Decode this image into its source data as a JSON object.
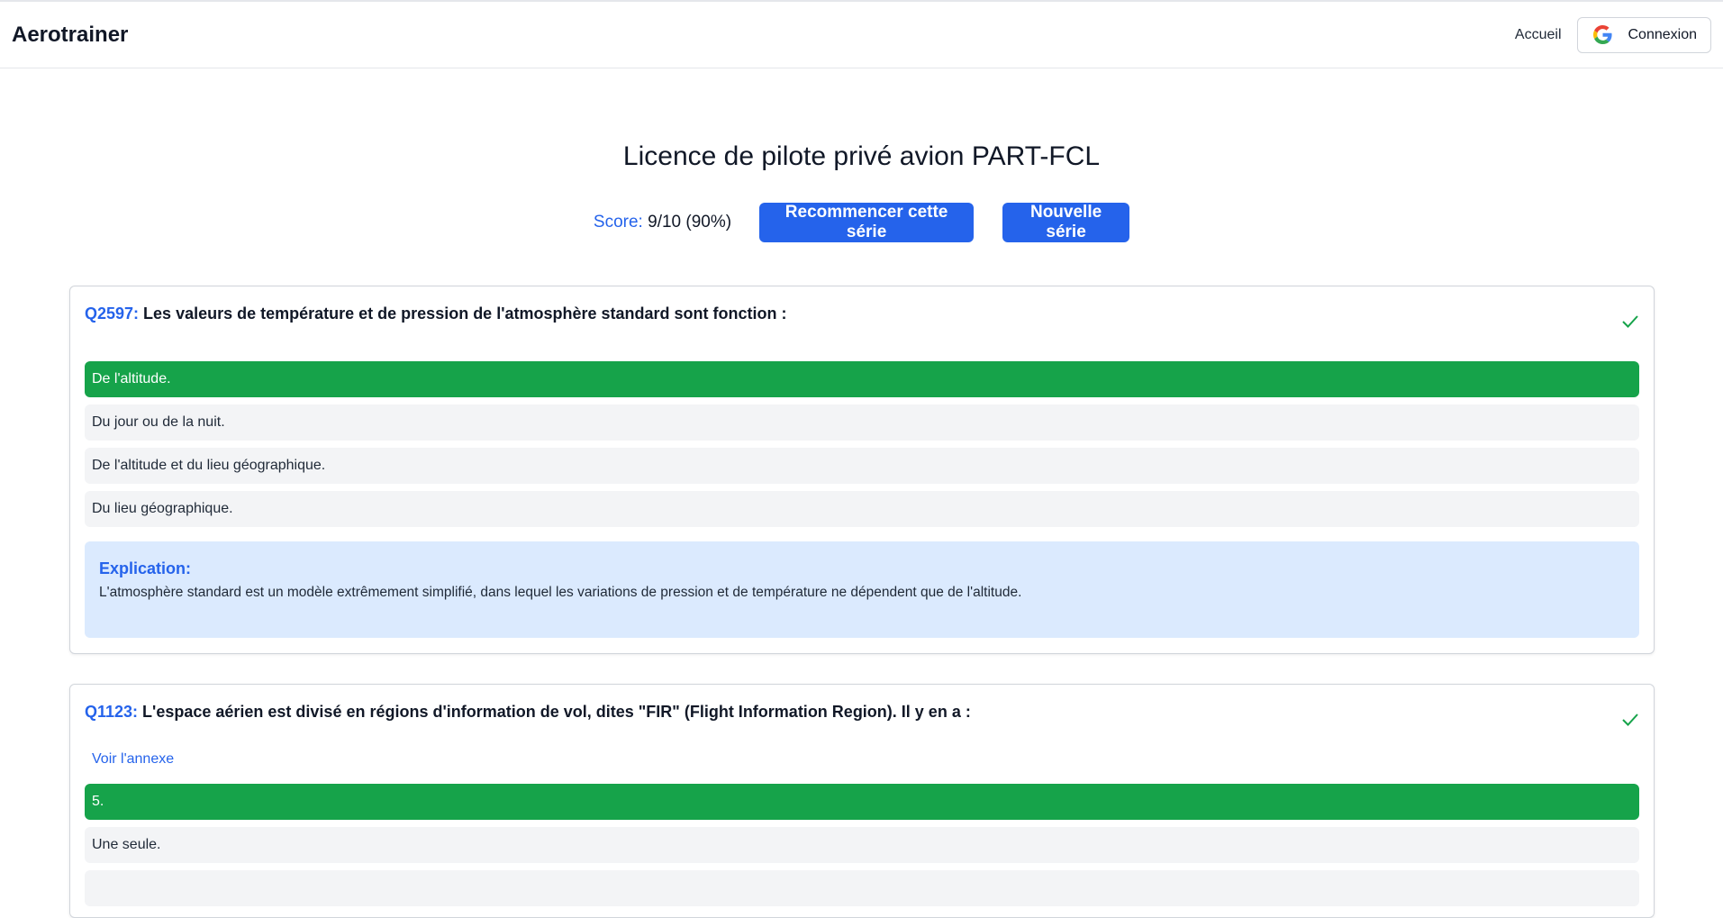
{
  "app": {
    "brand": "Aerotrainer"
  },
  "nav": {
    "home_label": "Accueil",
    "login_label": "Connexion",
    "login_icon": "google-icon"
  },
  "page": {
    "title": "Licence de pilote privé avion PART-FCL"
  },
  "score": {
    "label": "Score:",
    "value": "9/10 (90%)"
  },
  "actions": {
    "restart_label": "Recommencer cette série",
    "new_label": "Nouvelle série"
  },
  "colors": {
    "accent": "#2563eb",
    "correct": "#16a34a",
    "explain_bg": "#dbeafe",
    "answer_bg": "#f3f4f6"
  },
  "questions": [
    {
      "id": "Q2597:",
      "text": " Les valeurs de température et de pression de l'atmosphère standard sont fonction :",
      "status_icon": "check-icon",
      "answers": [
        {
          "text": "De l'altitude.",
          "correct": true
        },
        {
          "text": "Du jour ou de la nuit.",
          "correct": false
        },
        {
          "text": "De l'altitude et du lieu géographique.",
          "correct": false
        },
        {
          "text": "Du lieu géographique.",
          "correct": false
        }
      ],
      "explanation": {
        "title": "Explication:",
        "text": "L'atmosphère standard est un modèle extrêmement simplifié, dans lequel les variations de pression et de température ne dépendent que de l'altitude."
      }
    },
    {
      "id": "Q1123:",
      "text": " L'espace aérien est divisé en régions d'information de vol, dites \"FIR\" (Flight Information Region). Il y en a :",
      "status_icon": "check-icon",
      "annex_label": "Voir l'annexe",
      "answers": [
        {
          "text": "5.",
          "correct": true
        },
        {
          "text": "Une seule.",
          "correct": false
        },
        {
          "text": "",
          "correct": false
        }
      ]
    }
  ]
}
